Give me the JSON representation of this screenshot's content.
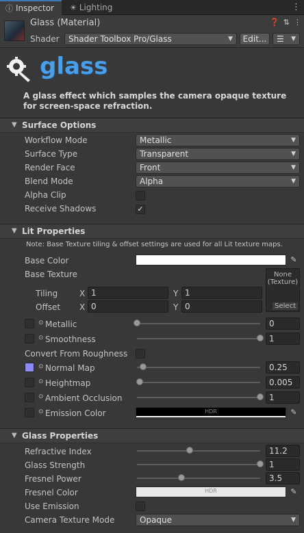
{
  "tabs": [
    {
      "label": "Inspector",
      "icon": "info-icon"
    },
    {
      "label": "Lighting",
      "icon": "lightbulb-icon"
    }
  ],
  "header": {
    "title": "Glass (Material)",
    "shader_label": "Shader",
    "shader_value": "Shader Toolbox Pro/Glass",
    "edit_label": "Edit...",
    "menu_icon": "list-menu-icon"
  },
  "logo": {
    "text": "glass",
    "description": "A glass effect which samples the camera opaque texture for screen-space refraction."
  },
  "surface": {
    "title": "Surface Options",
    "workflow_label": "Workflow Mode",
    "workflow_value": "Metallic",
    "surface_type_label": "Surface Type",
    "surface_type_value": "Transparent",
    "render_face_label": "Render Face",
    "render_face_value": "Front",
    "blend_label": "Blend Mode",
    "blend_value": "Alpha",
    "alpha_clip_label": "Alpha Clip",
    "alpha_clip": false,
    "shadows_label": "Receive Shadows",
    "shadows": true
  },
  "lit": {
    "title": "Lit Properties",
    "note": "Note: Base Texture tiling & offset settings are used for all Lit texture maps.",
    "base_color_label": "Base Color",
    "base_texture_label": "Base Texture",
    "tiling_label": "Tiling",
    "offset_label": "Offset",
    "x_label": "X",
    "y_label": "Y",
    "tiling_x": "1",
    "tiling_y": "1",
    "offset_x": "0",
    "offset_y": "0",
    "none_line1": "None",
    "none_line2": "(Texture)",
    "select_label": "Select",
    "metallic_label": "Metallic",
    "metallic_value": "0",
    "metallic_frac": 0,
    "smoothness_label": "Smoothness",
    "smoothness_value": "1",
    "smoothness_frac": 1,
    "convert_label": "Convert From Roughness",
    "convert": false,
    "normal_label": "Normal Map",
    "normal_value": "0.25",
    "normal_frac": 0.05,
    "height_label": "Heightmap",
    "height_value": "0.005",
    "height_frac": 0.02,
    "ao_label": "Ambient Occlusion",
    "ao_value": "1",
    "ao_frac": 1,
    "emission_label": "Emission Color",
    "emission_tag": "HDR"
  },
  "glass": {
    "title": "Glass Properties",
    "refr_label": "Refractive Index",
    "refr_value": "11.2",
    "refr_frac": 0.43,
    "strength_label": "Glass Strength",
    "strength_value": "1",
    "strength_frac": 1,
    "fresnel_power_label": "Fresnel Power",
    "fresnel_power_value": "3.5",
    "fresnel_power_frac": 0.36,
    "fresnel_color_label": "Fresnel Color",
    "fresnel_color_tag": "HDR",
    "use_emission_label": "Use Emission",
    "use_emission": false,
    "cam_tex_label": "Camera Texture Mode",
    "cam_tex_value": "Opaque"
  },
  "colors": {
    "accent": "#3a79bb",
    "panel_bg": "#383838",
    "normal_map_swatch": "#8a8af8",
    "logo_blue": "#4a9fe8"
  }
}
